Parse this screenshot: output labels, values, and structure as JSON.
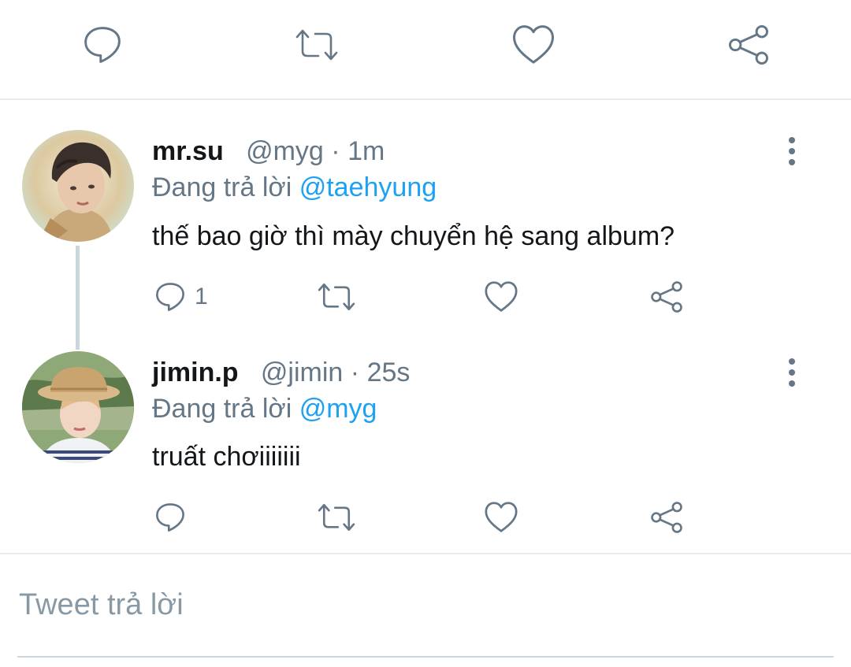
{
  "top_actions": {
    "reply_icon": "reply-icon",
    "retweet_icon": "retweet-icon",
    "like_icon": "heart-icon",
    "share_icon": "share-icon"
  },
  "tweets": [
    {
      "display_name": "mr.su",
      "handle": "@myg",
      "separator": "·",
      "time": "1m",
      "replying_prefix": "Đang trả lời",
      "replying_to": "@taehyung",
      "text": "thế bao giờ thì mày chuyển hệ sang album?",
      "reply_count": "1"
    },
    {
      "display_name": "jimin.p",
      "handle": "@jimin",
      "separator": "·",
      "time": "25s",
      "replying_prefix": "Đang trả lời",
      "replying_to": "@myg",
      "text": "truất chơiiiiiii",
      "reply_count": ""
    }
  ],
  "compose": {
    "placeholder": "Tweet trả lời"
  },
  "colors": {
    "accent": "#1da1f2",
    "secondary_text": "#657786",
    "divider": "#e6ecf0"
  }
}
